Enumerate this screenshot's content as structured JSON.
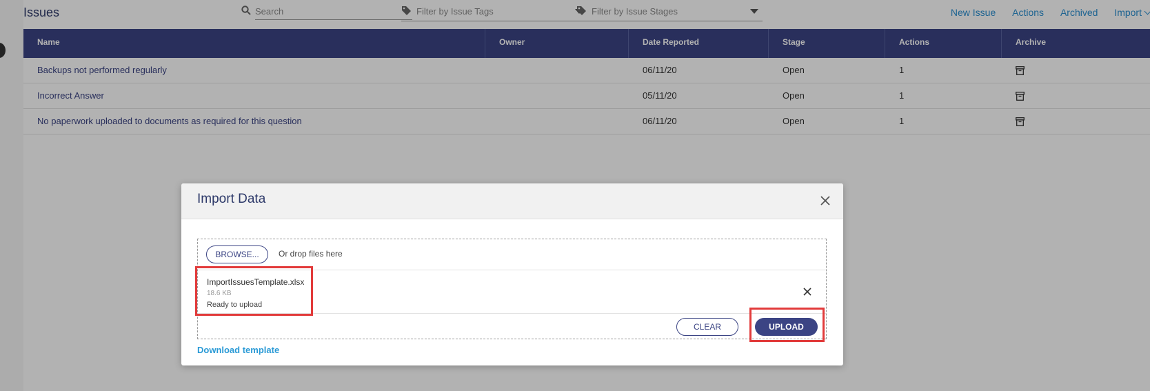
{
  "header": {
    "title": "Issues",
    "search_placeholder": "Search",
    "filter_tags": "Filter by Issue Tags",
    "filter_stages": "Filter by Issue Stages",
    "links": {
      "new_issue": "New Issue",
      "actions": "Actions",
      "archived": "Archived",
      "import": "Import"
    }
  },
  "table": {
    "columns": [
      "Name",
      "Owner",
      "Date Reported",
      "Stage",
      "Actions",
      "Archive"
    ],
    "rows": [
      {
        "name": "Backups not performed regularly",
        "owner": "",
        "date": "06/11/20",
        "stage": "Open",
        "actions": "1"
      },
      {
        "name": "Incorrect Answer",
        "owner": "",
        "date": "05/11/20",
        "stage": "Open",
        "actions": "1"
      },
      {
        "name": "No paperwork uploaded to documents as required for this question",
        "owner": "",
        "date": "06/11/20",
        "stage": "Open",
        "actions": "1"
      }
    ]
  },
  "modal": {
    "title": "Import Data",
    "browse_label": "BROWSE...",
    "drop_hint": "Or drop files here",
    "file": {
      "name": "ImportIssuesTemplate.xlsx",
      "size": "18.6 KB",
      "status": "Ready to upload"
    },
    "clear_label": "CLEAR",
    "upload_label": "UPLOAD",
    "download_label": "Download template"
  },
  "colors": {
    "header_bg": "#3b4484",
    "link": "#2a8fd0",
    "highlight": "#e23b3b"
  }
}
